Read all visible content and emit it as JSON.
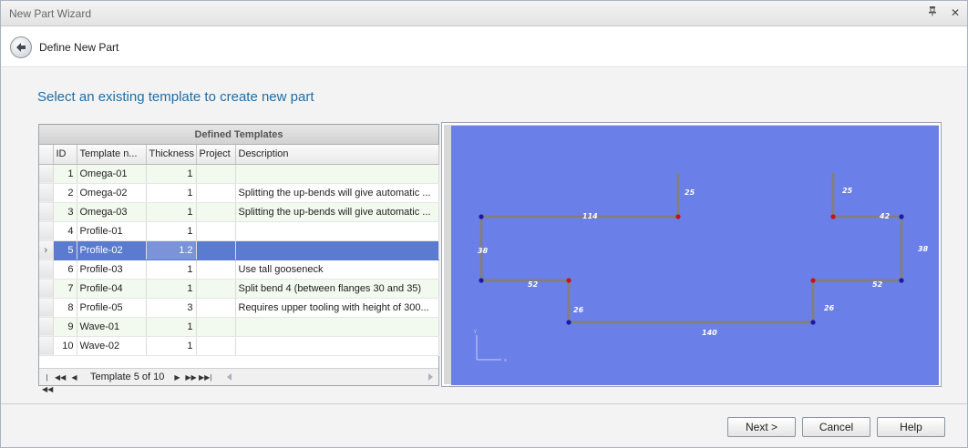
{
  "window": {
    "title": "New Part Wizard",
    "pin_icon": "pin-icon",
    "close_icon": "close-icon"
  },
  "header": {
    "back_icon": "back-arrow-icon",
    "title": "Define New Part"
  },
  "main": {
    "heading": "Select an existing template to create new part"
  },
  "templates": {
    "caption": "Defined Templates",
    "columns": [
      "ID",
      "Template n...",
      "Thickness",
      "Project",
      "Description"
    ],
    "rows": [
      {
        "id": "1",
        "name": "Omega-01",
        "thickness": "1",
        "project": "",
        "description": ""
      },
      {
        "id": "2",
        "name": "Omega-02",
        "thickness": "1",
        "project": "",
        "description": "Splitting the up-bends will give automatic ..."
      },
      {
        "id": "3",
        "name": "Omega-03",
        "thickness": "1",
        "project": "",
        "description": "Splitting the up-bends will give automatic ..."
      },
      {
        "id": "4",
        "name": "Profile-01",
        "thickness": "1",
        "project": "",
        "description": ""
      },
      {
        "id": "5",
        "name": "Profile-02",
        "thickness": "1.2",
        "project": "",
        "description": ""
      },
      {
        "id": "6",
        "name": "Profile-03",
        "thickness": "1",
        "project": "",
        "description": "Use tall gooseneck"
      },
      {
        "id": "7",
        "name": "Profile-04",
        "thickness": "1",
        "project": "",
        "description": "Split bend 4 (between flanges 30 and 35)"
      },
      {
        "id": "8",
        "name": "Profile-05",
        "thickness": "3",
        "project": "",
        "description": "Requires upper tooling with height of 300..."
      },
      {
        "id": "9",
        "name": "Wave-01",
        "thickness": "1",
        "project": "",
        "description": ""
      },
      {
        "id": "10",
        "name": "Wave-02",
        "thickness": "1",
        "project": "",
        "description": ""
      }
    ],
    "selected_row_id": "5",
    "row_indicator": "›",
    "nav_text": "Template 5 of 10"
  },
  "preview": {
    "background_color": "#6a7fe8",
    "segment_color": "#808080",
    "up_bend_color": "#cc1111",
    "down_bend_color": "#1a1aa8",
    "dimensions": [
      "25",
      "114",
      "38",
      "52",
      "26",
      "140",
      "26",
      "52",
      "38",
      "42",
      "25"
    ],
    "axis_labels": {
      "x": "x",
      "y": "y"
    }
  },
  "footer": {
    "next_label": "Next >",
    "cancel_label": "Cancel",
    "help_label": "Help"
  }
}
